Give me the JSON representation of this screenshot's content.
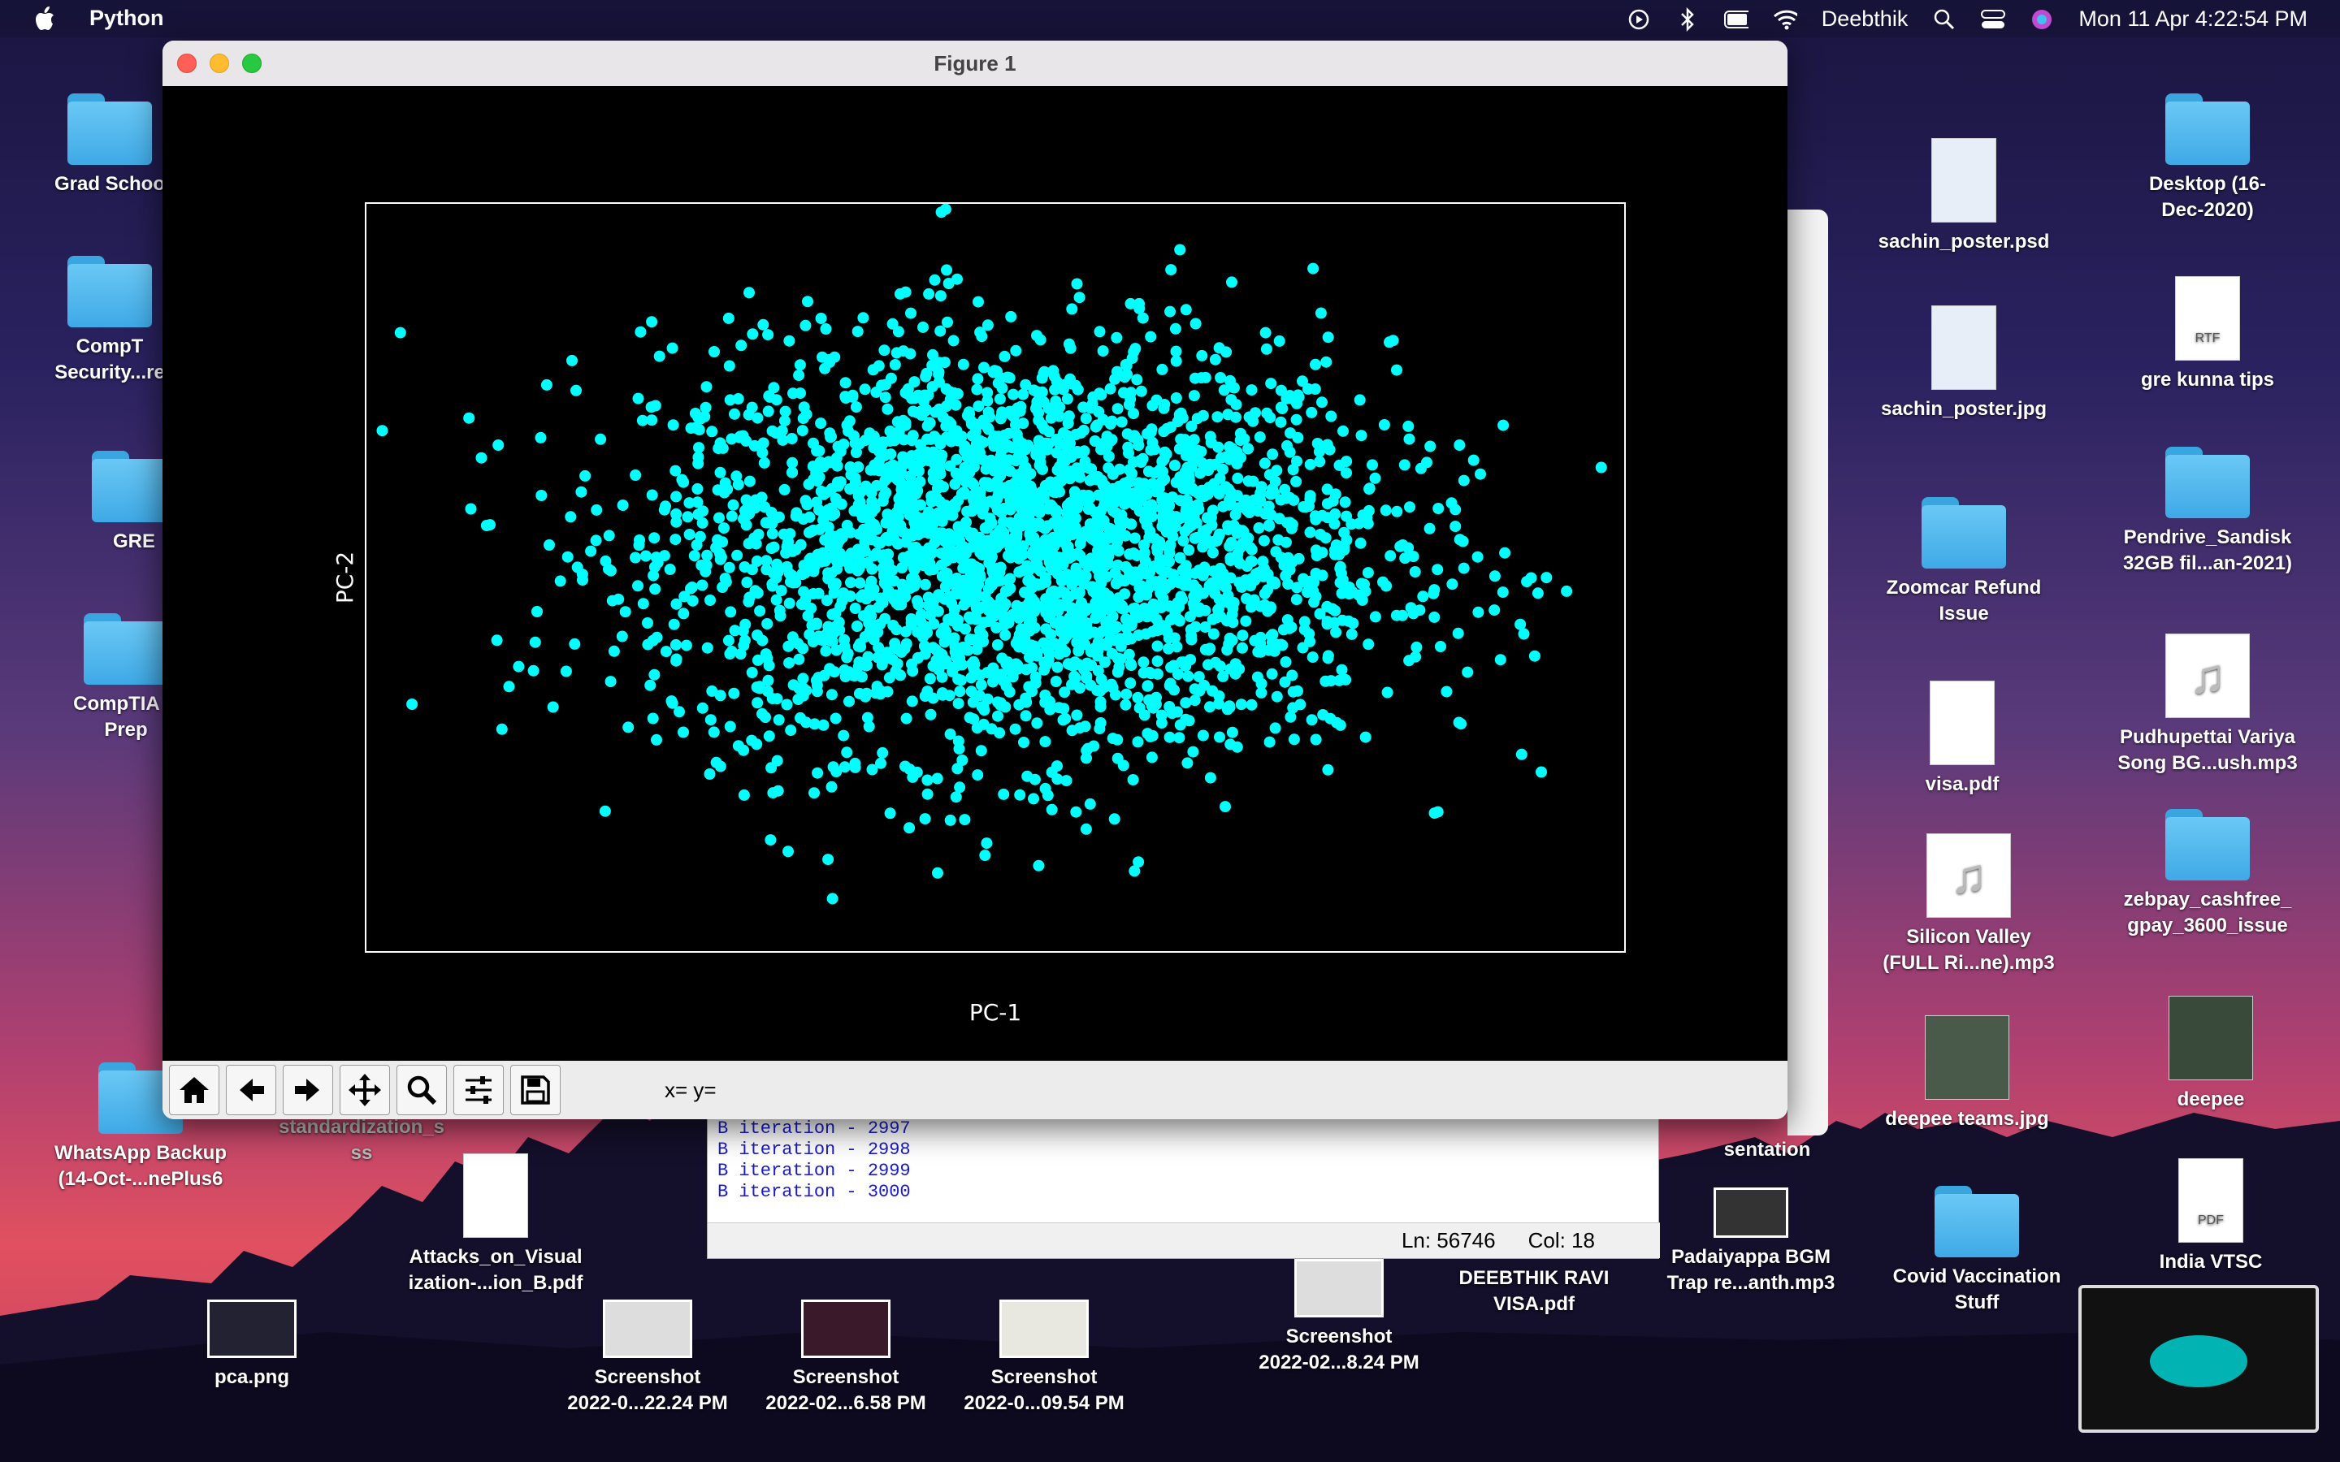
{
  "menubar": {
    "app": "Python",
    "user": "Deebthik",
    "clock": "Mon 11 Apr  4:22:54 PM"
  },
  "window": {
    "title": "Figure 1",
    "coords_label": "x= y="
  },
  "console": {
    "lines": [
      "B iteration - 2997",
      "B iteration - 2998",
      "B iteration - 2999",
      "B iteration - 3000"
    ],
    "ln": "Ln: 56746",
    "col": "Col: 18"
  },
  "desktop": {
    "grad": "Grad Schoo",
    "comptia_sec": "CompT\nSecurity...re",
    "gre": "GRE",
    "comptia_prep": "CompTIA C\nPrep",
    "whatsapp": "WhatsApp Backup\n(14-Oct-...nePlus6",
    "pca": "pca.png",
    "standard": "standardization_s\nss",
    "attacks": "Attacks_on_Visual\nization-...ion_B.pdf",
    "s1": "Screenshot\n2022-0...22.24 PM",
    "s2": "Screenshot\n2022-02...6.58 PM",
    "s3": "Screenshot\n2022-0...09.54 PM",
    "s4": "Screenshot\n2022-02...8.24 PM",
    "visa_ravi": "DEEBTHIK RAVI\nVISA.pdf",
    "padaiyappa": "Padaiyappa BGM\nTrap re...anth.mp3",
    "covid": "Covid Vaccination\nStuff",
    "india": "India VTSC",
    "sachin_psd": "sachin_poster.psd",
    "sachin_jpg": "sachin_poster.jpg",
    "zoomcar": "Zoomcar Refund\nIssue",
    "visa": "visa.pdf",
    "silicon": "Silicon Valley\n(FULL Ri...ne).mp3",
    "deepee_teams": "deepee teams.jpg",
    "desktop16": "Desktop (16-\nDec-2020)",
    "gre_tips": "gre kunna tips",
    "pendrive": "Pendrive_Sandisk\n32GB fil...an-2021)",
    "pudhu": "Pudhupettai Variya\nSong BG...ush.mp3",
    "zebpay": "zebpay_cashfree_\ngpay_3600_issue",
    "deepee": "deepee",
    "rtf": "RTF",
    "pdf": "PDF",
    "presentation": "sentation"
  },
  "chart_data": {
    "type": "scatter",
    "xlabel": "PC-1",
    "ylabel": "PC-2",
    "title": "",
    "xlim": [
      -4.8,
      4.8
    ],
    "ylim": [
      -4,
      4
    ],
    "n_points": 3000,
    "distribution": "2D Gaussian cloud, std x≈1.4, std y≈1.1, centered at (0.2,0.3)",
    "color": "#00ffff",
    "background": "#000000"
  },
  "colors": {
    "accent": "#00ffff"
  }
}
